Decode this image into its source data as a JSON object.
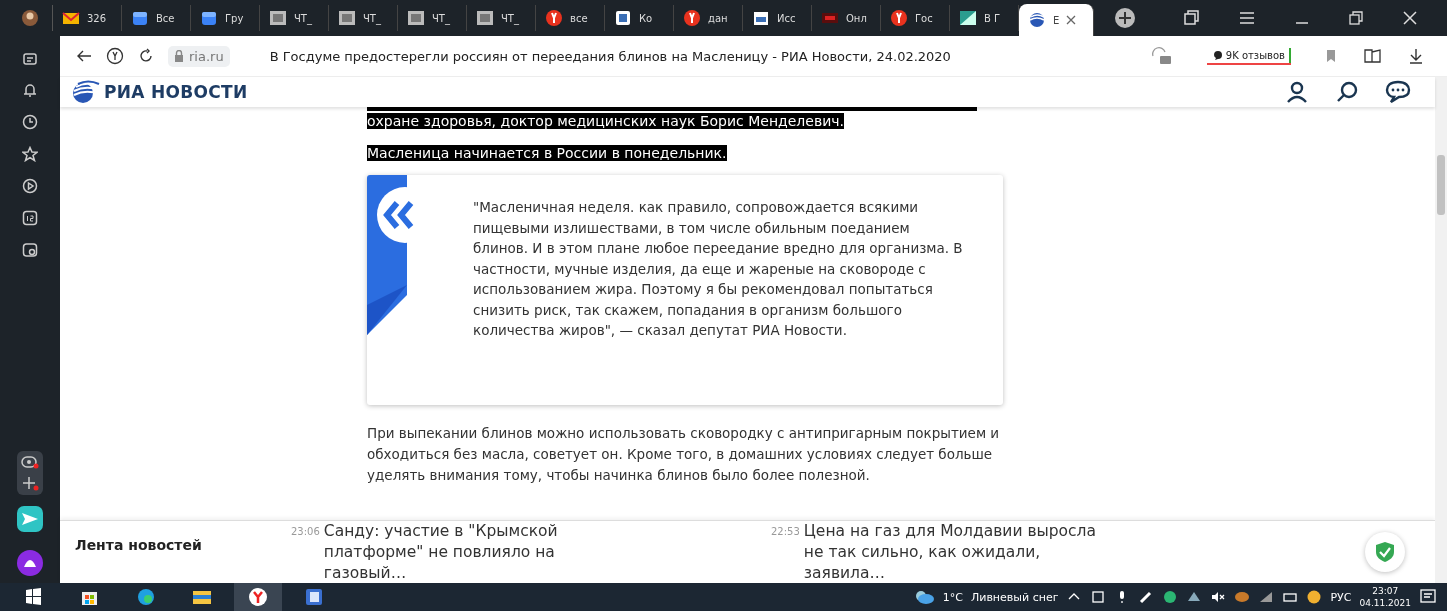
{
  "tabs": [
    {
      "kind": "avatar",
      "selected": false
    },
    {
      "kind": "mail",
      "label": "326",
      "selected": false
    },
    {
      "kind": "cube",
      "label": "Все",
      "selected": false
    },
    {
      "kind": "cube",
      "label": "Гру",
      "selected": false
    },
    {
      "kind": "photo",
      "label": "ЧТ_",
      "selected": false
    },
    {
      "kind": "photo",
      "label": "ЧТ_",
      "selected": false
    },
    {
      "kind": "photo",
      "label": "ЧТ_",
      "selected": false
    },
    {
      "kind": "photo",
      "label": "ЧТ_",
      "selected": false
    },
    {
      "kind": "yandex",
      "label": "все",
      "selected": false
    },
    {
      "kind": "doc",
      "label": "Ко",
      "selected": false
    },
    {
      "kind": "yandex",
      "label": "дан",
      "selected": false
    },
    {
      "kind": "tool",
      "label": "Исс",
      "selected": false
    },
    {
      "kind": "red",
      "label": "Онл",
      "selected": false
    },
    {
      "kind": "yandex",
      "label": "Гос",
      "selected": false
    },
    {
      "kind": "image",
      "label": "В Г",
      "selected": false
    },
    {
      "kind": "ria",
      "label": "Е",
      "selected": true
    }
  ],
  "address_bar": {
    "domain": "ria.ru",
    "title": "В Госдуме предостерегли россиян от переедания блинов на Масленицу - РИА Новости, 24.02.2020",
    "reviews": "9K отзывов",
    "bookmarked": false
  },
  "site_header": {
    "logo": "РИА НОВОСТИ"
  },
  "article": {
    "paragraphs": [
      {
        "text": "охране здоровья, доктор медицинских наук Борис Менделевич.",
        "selected": true
      },
      {
        "text": "Масленица начинается в России в понедельник.",
        "selected": true
      }
    ],
    "quote": "\"Масленичная неделя. как правило, сопровождается всякими пищевыми излишествами, в том числе обильным поеданием блинов. И в этом плане любое переедание вредно для организма. В частности, мучные изделия, да еще и жареные на сковороде с использованием жира. Поэтому я бы рекомендовал попытаться снизить риск, так скажем, попадания в организм большого количества жиров\", — сказал депутат РИА Новости.",
    "after": [
      {
        "text": "При выпекании блинов можно использовать сковородку с антипригарным покрытием и обходиться без масла, советует он. Кроме того, в домашних условиях следует больше уделять внимания тому, чтобы начинка блинов было более полезной.",
        "selected": false
      }
    ]
  },
  "news_feed": {
    "title": "Лента новостей",
    "items": [
      {
        "time": "23:06",
        "text": "Санду: участие в \"Крымской платформе\" не повлияло на газовый…"
      },
      {
        "time": "22:53",
        "text": "Цена на газ для Молдавии выросла не так сильно, как ожидали, заявила…"
      }
    ]
  },
  "taskbar": {
    "weather": "1°C",
    "condition": "Ливневый снег",
    "language": "РУС",
    "time": "23:07",
    "date": "04.11.2021"
  }
}
